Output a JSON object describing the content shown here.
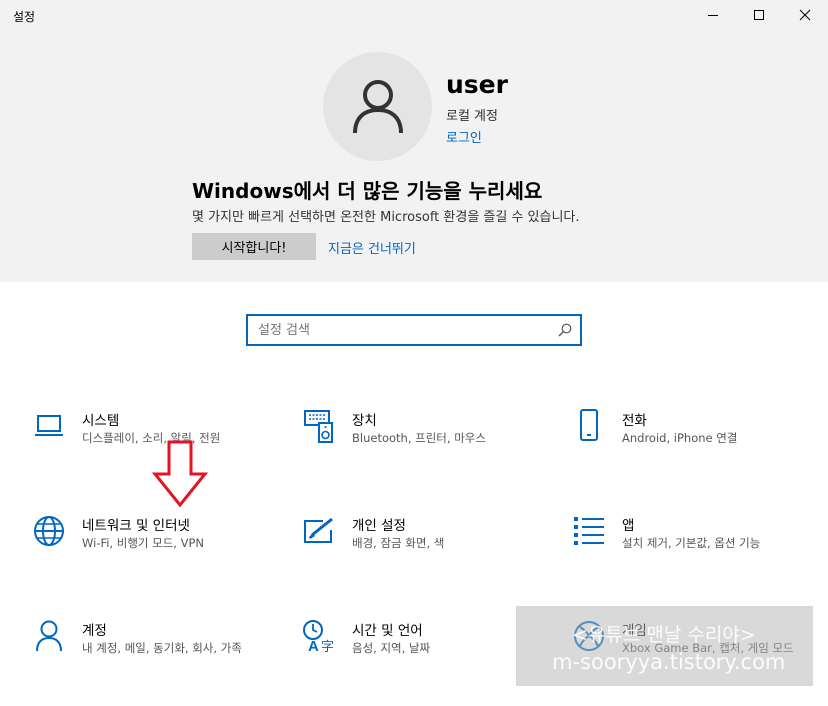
{
  "window": {
    "title": "설정"
  },
  "account": {
    "username": "user",
    "account_type": "로컬 계정",
    "login_link": "로그인"
  },
  "promo": {
    "title": "Windows에서 더 많은 기능을 누리세요",
    "description": "몇 가지만 빠르게 선택하면 온전한 Microsoft 환경을 즐길 수 있습니다.",
    "start_button": "시작합니다!",
    "skip_link": "지금은 건너뛰기"
  },
  "search": {
    "placeholder": "설정 검색"
  },
  "categories": [
    {
      "name": "시스템",
      "description": "디스플레이, 소리, 알림, 전원",
      "icon": "laptop-icon"
    },
    {
      "name": "장치",
      "description": "Bluetooth, 프린터, 마우스",
      "icon": "devices-icon"
    },
    {
      "name": "전화",
      "description": "Android, iPhone 연결",
      "icon": "phone-icon"
    },
    {
      "name": "네트워크 및 인터넷",
      "description": "Wi-Fi, 비행기 모드, VPN",
      "icon": "globe-icon"
    },
    {
      "name": "개인 설정",
      "description": "배경, 잠금 화면, 색",
      "icon": "personalization-icon"
    },
    {
      "name": "앱",
      "description": "설치 제거, 기본값, 옵션 기능",
      "icon": "apps-list-icon"
    },
    {
      "name": "계정",
      "description": "내 계정, 메일, 동기화, 회사, 가족",
      "icon": "person-icon"
    },
    {
      "name": "시간 및 언어",
      "description": "음성, 지역, 날짜",
      "icon": "time-language-icon"
    },
    {
      "name": "게임",
      "description": "Xbox Game Bar, 캡처, 게임 모드",
      "icon": "xbox-icon"
    }
  ],
  "watermark": {
    "line1": "<유튜브 맨날 수리야>",
    "line2": "m-sooryya.tistory.com"
  },
  "colors": {
    "accent": "#0067c0",
    "hero_background": "#f2f2f2",
    "annotation_arrow": "#e81123"
  }
}
